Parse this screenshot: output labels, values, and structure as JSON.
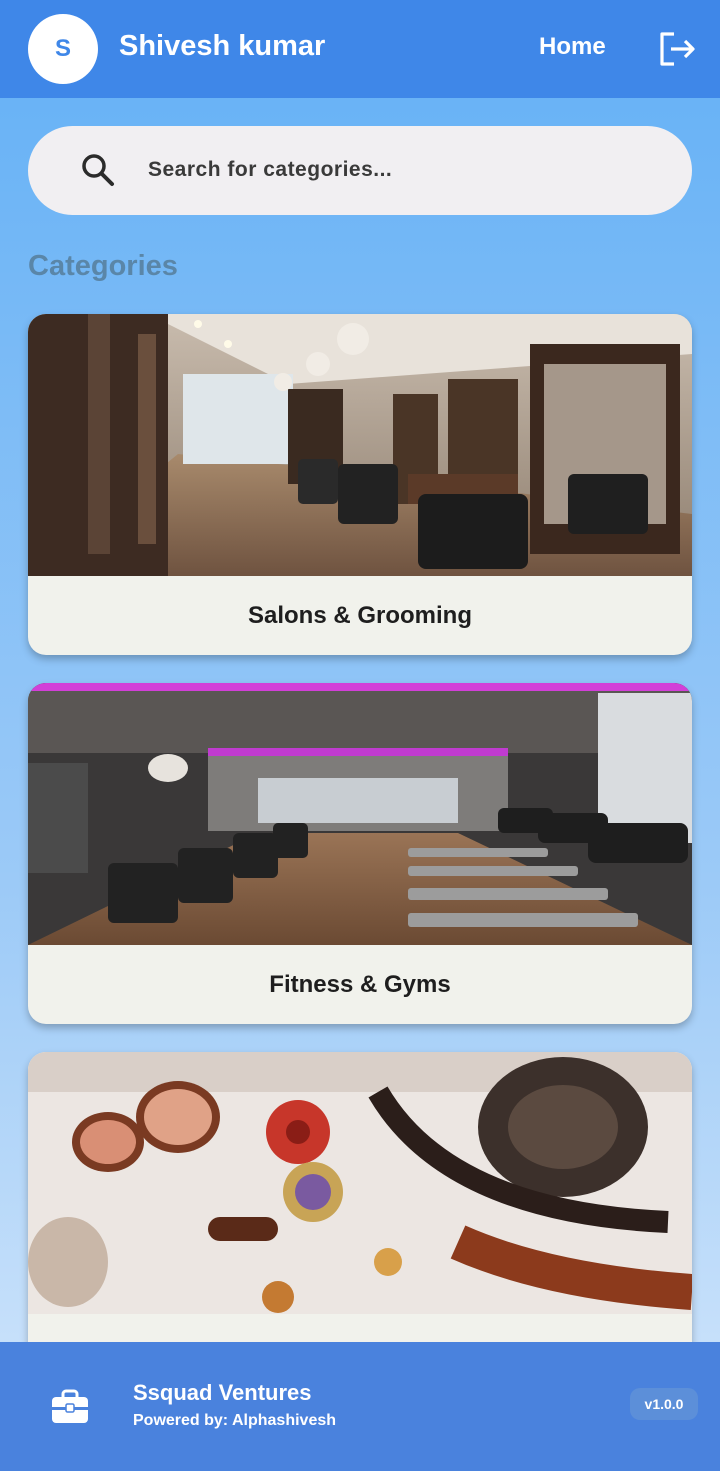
{
  "header": {
    "avatar_initial": "S",
    "user_name": "Shivesh kumar",
    "home_label": "Home",
    "logout_icon": "logout-icon"
  },
  "search": {
    "placeholder": "Search for categories...",
    "value": "",
    "icon": "search-icon"
  },
  "section_title": "Categories",
  "categories": [
    {
      "label": "Salons & Grooming",
      "image": "salon-interior-photo"
    },
    {
      "label": "Fitness & Gyms",
      "image": "gym-interior-photo"
    },
    {
      "label": "",
      "image": "fashion-accessories-photo"
    }
  ],
  "footer": {
    "icon": "briefcase-icon",
    "company": "Ssquad Ventures",
    "powered_by": "Powered by: Alphashivesh",
    "version": "v1.0.0"
  },
  "colors": {
    "header_bg": "#3f87e8",
    "footer_bg": "#4a82dd",
    "section_title": "#5a86a8",
    "card_bg": "#f1f2ec"
  }
}
